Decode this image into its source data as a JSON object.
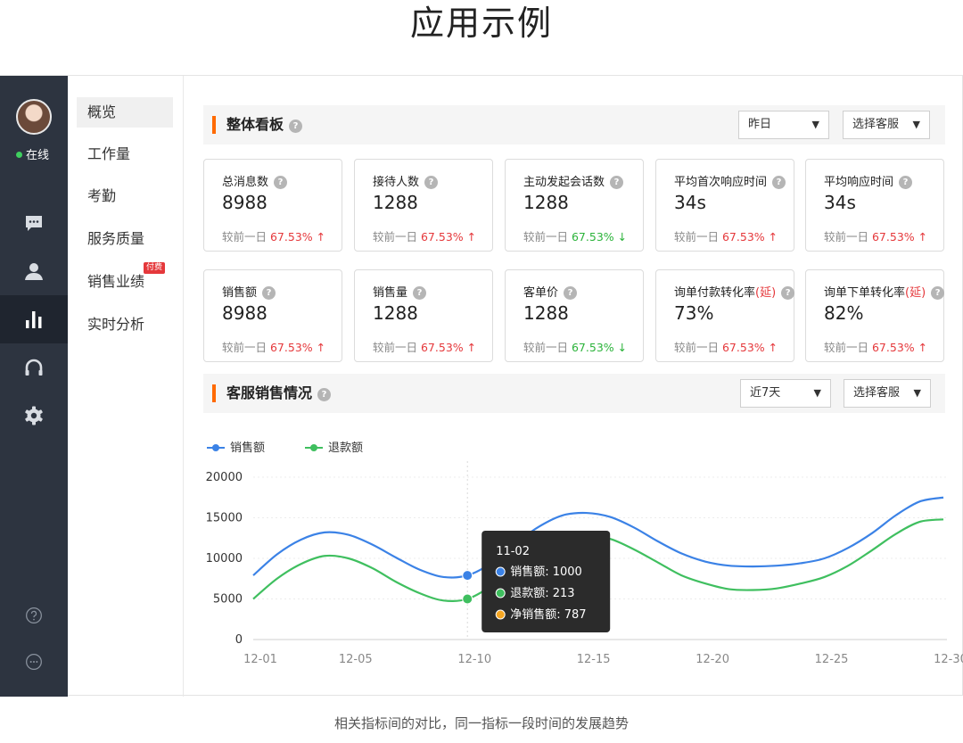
{
  "page": {
    "heading": "应用示例",
    "caption": "相关指标间的对比，同一指标一段时间的发展趋势"
  },
  "rail": {
    "status": "在线",
    "icons": [
      "chat-icon",
      "user-icon",
      "chart-icon",
      "headset-icon",
      "gear-icon",
      "help-icon",
      "more-icon"
    ]
  },
  "subnav": {
    "items": [
      {
        "label": "概览",
        "active": true
      },
      {
        "label": "工作量"
      },
      {
        "label": "考勤"
      },
      {
        "label": "服务质量"
      },
      {
        "label": "销售业绩",
        "badge": "付费"
      },
      {
        "label": "实时分析"
      }
    ]
  },
  "dashboard": {
    "title": "整体看板",
    "help": "?",
    "period": "昨日",
    "agent": "选择客服",
    "caret": "▼",
    "compare_prefix": "较前一日",
    "cards": [
      {
        "label": "总消息数",
        "value": "8988",
        "pct": "67.53%",
        "trend": "up",
        "arrow": "↑"
      },
      {
        "label": "接待人数",
        "value": "1288",
        "pct": "67.53%",
        "trend": "up",
        "arrow": "↑"
      },
      {
        "label": "主动发起会话数",
        "value": "1288",
        "pct": "67.53%",
        "trend": "down",
        "arrow": "↓"
      },
      {
        "label": "平均首次响应时间",
        "value": "34s",
        "pct": "67.53%",
        "trend": "up",
        "arrow": "↑"
      },
      {
        "label": "平均响应时间",
        "value": "34s",
        "pct": "67.53%",
        "trend": "up",
        "arrow": "↑"
      },
      {
        "label": "销售额",
        "value": "8988",
        "pct": "67.53%",
        "trend": "up",
        "arrow": "↑"
      },
      {
        "label": "销售量",
        "value": "1288",
        "pct": "67.53%",
        "trend": "up",
        "arrow": "↑"
      },
      {
        "label": "客单价",
        "value": "1288",
        "pct": "67.53%",
        "trend": "down",
        "arrow": "↓"
      },
      {
        "label": "询单付款转化率",
        "delay": "(延)",
        "value": "73%",
        "pct": "67.53%",
        "trend": "up",
        "arrow": "↑"
      },
      {
        "label": "询单下单转化率",
        "delay": "(延)",
        "value": "82%",
        "pct": "67.53%",
        "trend": "up",
        "arrow": "↑"
      }
    ]
  },
  "sales": {
    "title": "客服销售情况",
    "help": "?",
    "period": "近7天",
    "agent": "选择客服",
    "caret": "▼",
    "tooltip": {
      "title": "11-02",
      "rows": [
        {
          "label": "销售额:",
          "value": "1000",
          "color": "#3b82e6"
        },
        {
          "label": "退款额:",
          "value": "213",
          "color": "#3fbf5f"
        },
        {
          "label": "净销售额:",
          "value": "787",
          "color": "#f5a623"
        }
      ]
    }
  },
  "colors": {
    "sales": "#3b82e6",
    "refund": "#3fbf5f",
    "net": "#f5a623",
    "accent": "#ff6a00",
    "up": "#e5383b",
    "down": "#2bb33a"
  },
  "chart_data": {
    "type": "line",
    "x": [
      "12-01",
      "12-02",
      "12-03",
      "12-04",
      "12-05",
      "12-06",
      "12-07",
      "12-08",
      "12-09",
      "12-10",
      "12-11",
      "12-12",
      "12-13",
      "12-14",
      "12-15",
      "12-16",
      "12-17",
      "12-18",
      "12-19",
      "12-20",
      "12-21",
      "12-22",
      "12-23",
      "12-24",
      "12-25",
      "12-26",
      "12-27",
      "12-28",
      "12-29",
      "12-30"
    ],
    "xticks": [
      "12-01",
      "12-05",
      "12-10",
      "12-15",
      "12-20",
      "12-25",
      "12-30"
    ],
    "series": [
      {
        "name": "销售额",
        "values": [
          7900,
          10500,
          12300,
          13200,
          12900,
          11700,
          10100,
          8600,
          7700,
          7900,
          9400,
          11800,
          13900,
          15300,
          15600,
          15100,
          13800,
          12100,
          10600,
          9600,
          9100,
          9000,
          9100,
          9400,
          10000,
          11300,
          13100,
          15300,
          17000,
          17500
        ]
      },
      {
        "name": "退款额",
        "values": [
          5000,
          7500,
          9300,
          10300,
          10000,
          8800,
          7100,
          5700,
          4800,
          5000,
          6600,
          9000,
          11100,
          12500,
          12800,
          12400,
          11100,
          9500,
          7900,
          6900,
          6200,
          6100,
          6300,
          6900,
          7700,
          9100,
          11000,
          13000,
          14500,
          14800
        ]
      }
    ],
    "ylim": [
      0,
      20000
    ],
    "yticks": [
      "0",
      "5000",
      "10000",
      "15000",
      "20000"
    ],
    "grid": true,
    "legend": "top-left",
    "highlight_index": 9
  }
}
